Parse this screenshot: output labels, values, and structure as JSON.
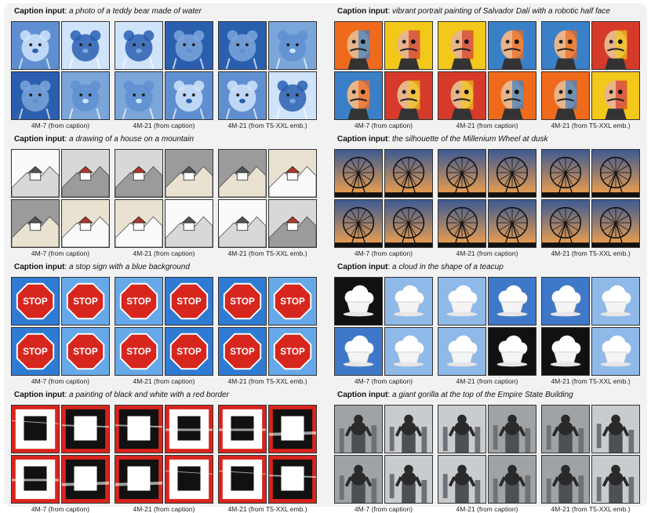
{
  "model_labels": [
    "4M-7 (from caption)",
    "4M-21 (from caption)",
    "4M-21 (from T5-XXL emb.)"
  ],
  "caption_prefix": "Caption input",
  "panels": [
    {
      "id": "teddy-water",
      "caption": "a photo of a teddy bear made of water",
      "subject": "teddy",
      "palette": [
        "#5f8fd0",
        "#cfe4fa",
        "#2a5fb0",
        "#7ba6da"
      ]
    },
    {
      "id": "dali-robot",
      "caption": "vibrant portrait painting of Salvador Dalí with a robotic half face",
      "subject": "dali",
      "palette": [
        "#f06a1c",
        "#f2c81a",
        "#3a80c8",
        "#d63a2a"
      ]
    },
    {
      "id": "house-mountain",
      "caption": "a drawing of a house on a mountain",
      "subject": "house",
      "palette": [
        "#fafafa",
        "#d8d8d8",
        "#9b9b9b",
        "#e9e2d0"
      ]
    },
    {
      "id": "millennium-wheel",
      "caption": "the silhouette of the Millenium Wheel at dusk",
      "subject": "wheel",
      "palette": [
        "#3d5a93",
        "#f6a24a",
        "#7891c4",
        "#f3c27a"
      ]
    },
    {
      "id": "stop-sign",
      "caption": "a stop sign with a blue background",
      "subject": "stop",
      "palette": [
        "#2f7bd3",
        "#d7261e",
        "#66a8e8",
        "#e23030"
      ]
    },
    {
      "id": "cloud-teacup",
      "caption": "a cloud in the shape of a teacup",
      "subject": "cloud",
      "palette": [
        "#3f78c8",
        "#ffffff",
        "#8fb9e8",
        "#111111"
      ]
    },
    {
      "id": "black-white-red",
      "caption": "a painting of black and white with a red border",
      "subject": "bwred",
      "palette": [
        "#111111",
        "#ffffff",
        "#d9241e",
        "#8a8a8a"
      ]
    },
    {
      "id": "gorilla-empire",
      "caption": "a giant gorilla at the top of the Empire State Building",
      "subject": "gorilla",
      "palette": [
        "#9fa3a6",
        "#2a2a2a",
        "#c9ccce",
        "#5a5e62"
      ]
    }
  ]
}
